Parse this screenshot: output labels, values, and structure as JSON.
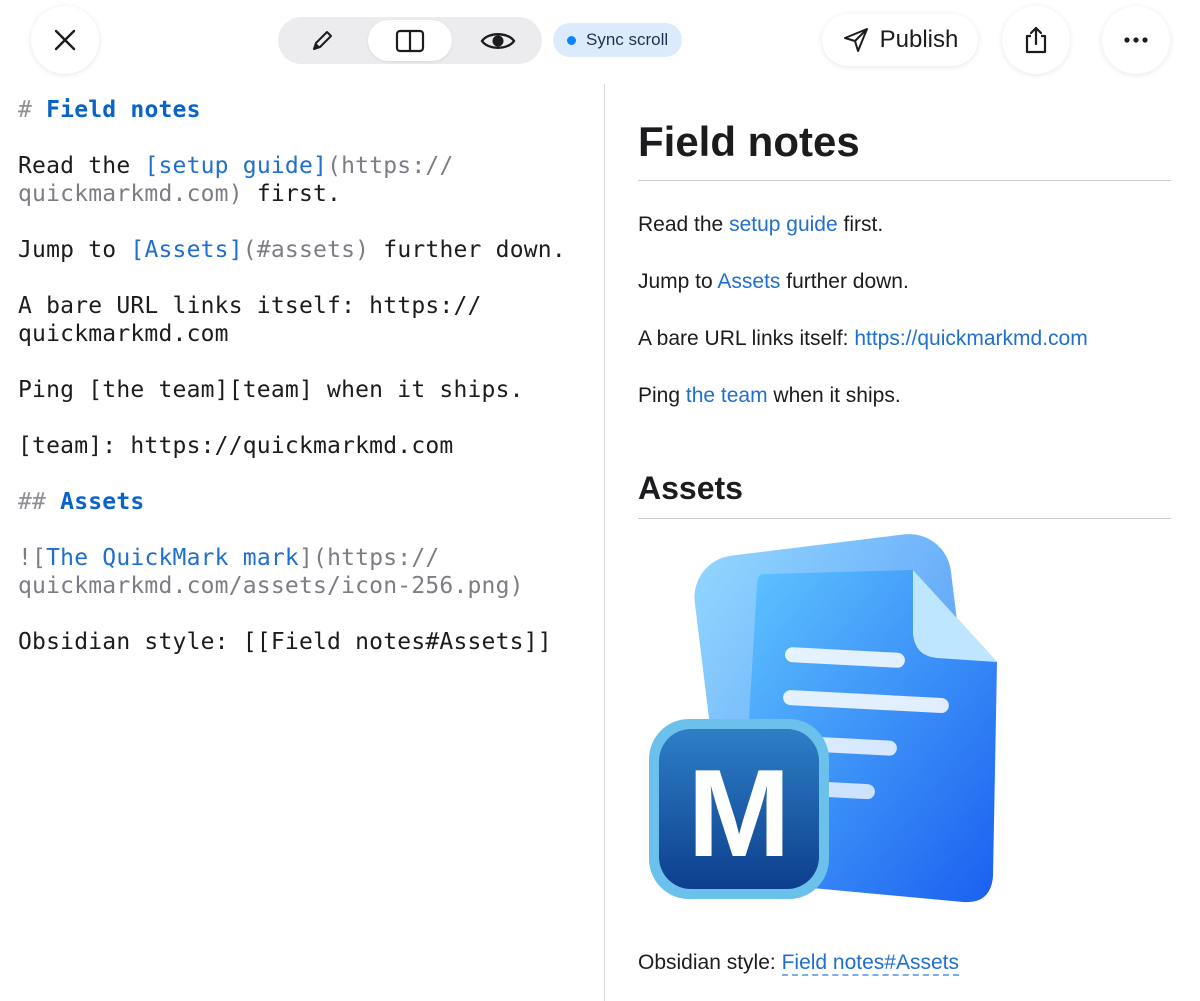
{
  "toolbar": {
    "close_icon": "close-icon",
    "modes": [
      {
        "name": "edit",
        "icon": "pencil-icon",
        "active": false
      },
      {
        "name": "split",
        "icon": "split-view-icon",
        "active": true
      },
      {
        "name": "preview",
        "icon": "eye-icon",
        "active": false
      }
    ],
    "sync_label": "Sync scroll",
    "publish_label": "Publish",
    "share_icon": "share-icon",
    "more_icon": "more-icon"
  },
  "editor": {
    "l1_mark": "# ",
    "l1_text": "Field notes",
    "l2_pre": "Read the ",
    "l2_link": "[setup guide]",
    "l2_url_a": "(https://",
    "l3_url_b": "quickmarkmd.com)",
    "l3_post": " first.",
    "l4_pre": "Jump to ",
    "l4_link": "[Assets]",
    "l4_url": "(#assets)",
    "l4_post": " further down.",
    "l5": "A bare URL links itself: https://",
    "l6": "quickmarkmd.com",
    "l7": "Ping [the team][team] when it ships.",
    "l8": "[team]: https://quickmarkmd.com",
    "l9_mark": "## ",
    "l9_text": "Assets",
    "l10_mark": "![",
    "l10_alt": "The QuickMark mark",
    "l10_end": "](https://",
    "l11": "quickmarkmd.com/assets/icon-256.png)",
    "l12": "Obsidian style: [[Field notes#Assets]]"
  },
  "preview": {
    "h1": "Field notes",
    "p1_pre": "Read the ",
    "p1_link": "setup guide",
    "p1_post": " first.",
    "p2_pre": "Jump to ",
    "p2_link": "Assets",
    "p2_post": " further down.",
    "p3_pre": "A bare URL links itself: ",
    "p3_link": "https://quickmarkmd.com",
    "p4_pre": "Ping ",
    "p4_link": "the team",
    "p4_post": " when it ships.",
    "h2": "Assets",
    "image_alt": "The QuickMark mark",
    "image_letter": "M",
    "p5_pre": "Obsidian style: ",
    "p5_link": "Field notes#Assets"
  },
  "colors": {
    "link": "#1f6fd1",
    "heading_mark": "#0a64c8",
    "accent": "#0a84ff"
  }
}
